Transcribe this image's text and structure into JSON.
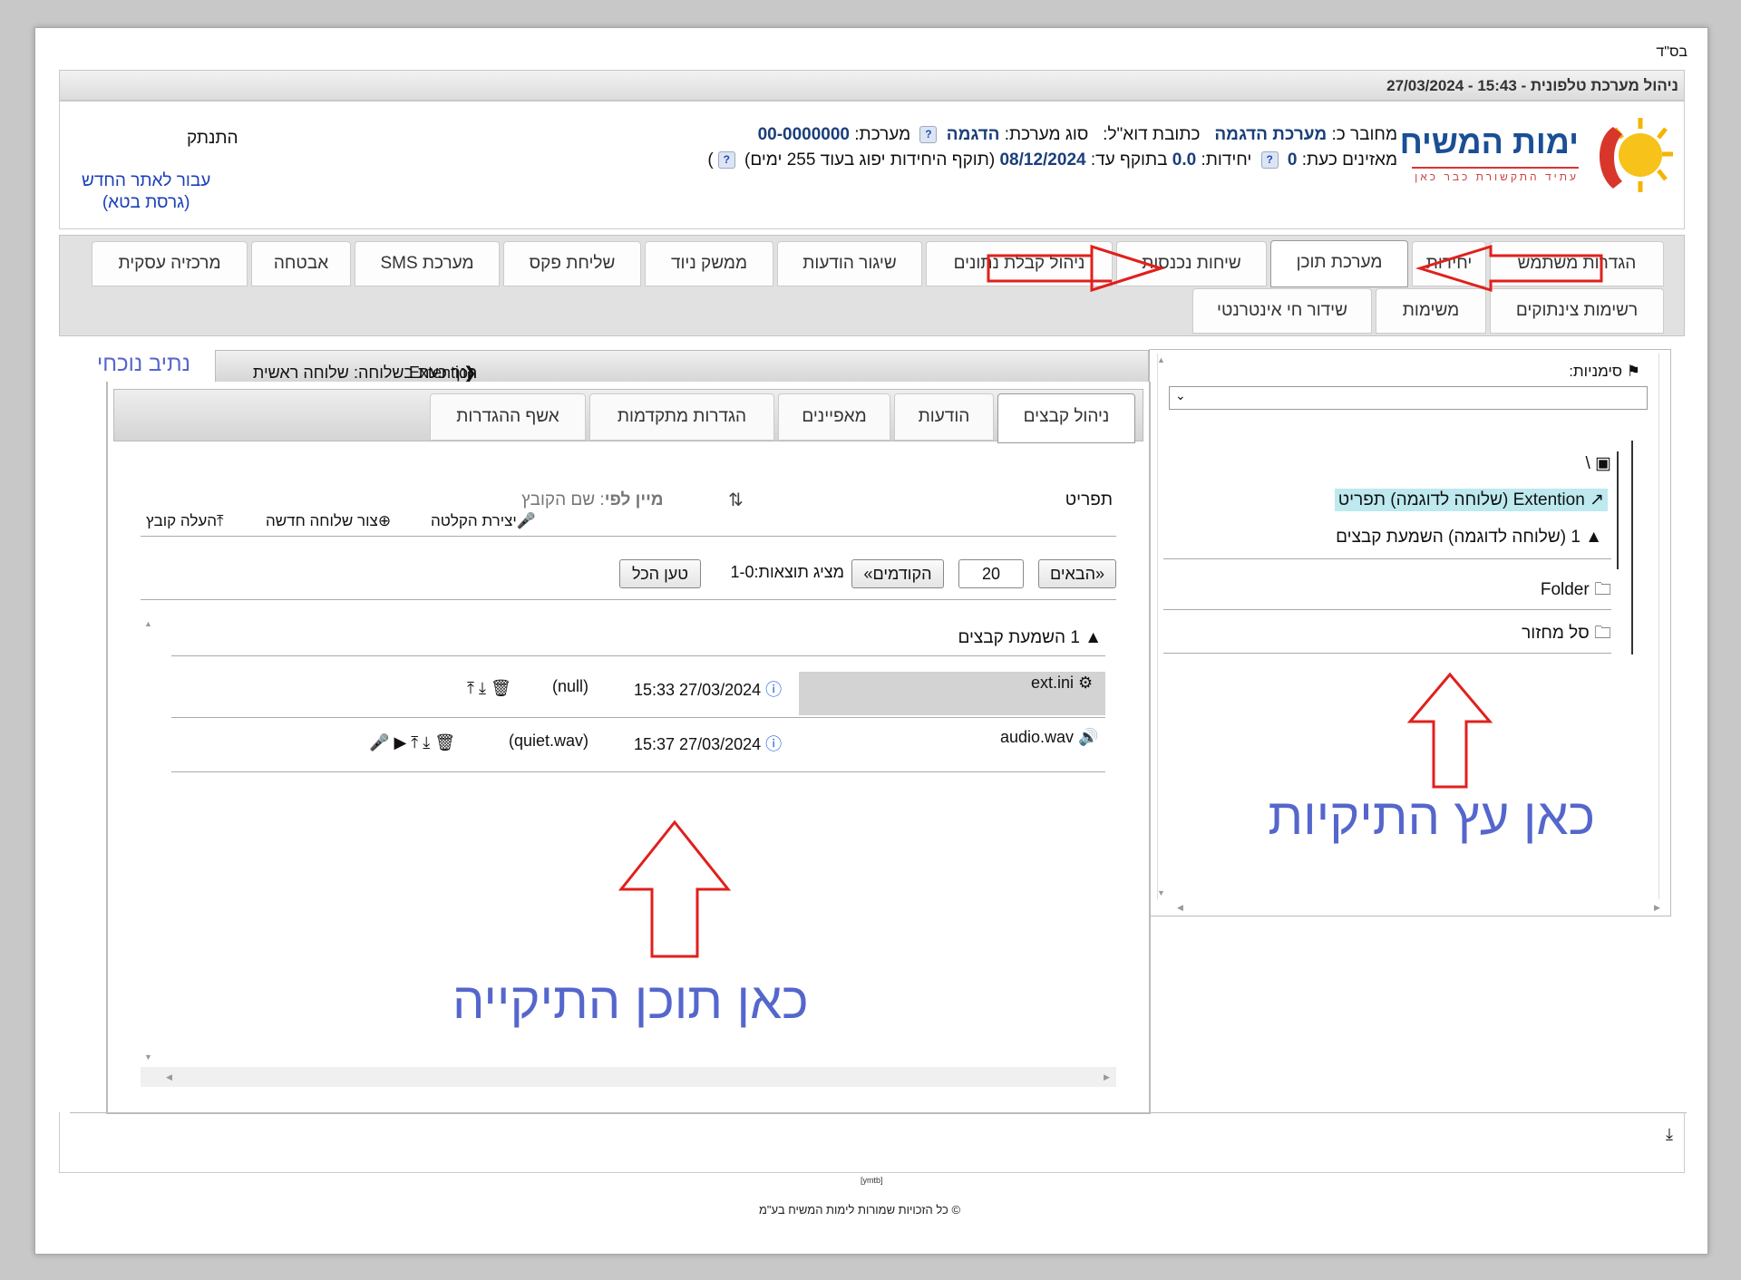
{
  "top": {
    "bsd": "בס\"ד",
    "title": "ניהול מערכת טלפונית - 15:43 - 27/03/2024"
  },
  "logo": {
    "name": "ימות המשיח",
    "slogan": "עתיד התקשורת כבר כאן"
  },
  "account": {
    "connected_label": "מחובר כ:",
    "connected_value": "מערכת הדגמה",
    "email_label": "כתובת דוא\"ל:",
    "system_type_label": "סוג מערכת:",
    "system_type_value": "הדגמה",
    "system_label": "מערכת:",
    "system_value": "00-0000000",
    "listeners_label": "מאזינים כעת:",
    "listeners_value": "0",
    "units_label": "יחידות:",
    "units_value": "0.0",
    "valid_label": "בתוקף עד:",
    "valid_value": "08/12/2024",
    "valid_note": "(תוקף היחידות יפוג בעוד 255 ימים)",
    "close_paren": ")",
    "help": "?"
  },
  "side_links": {
    "logout": "התנתק",
    "new_site_1": "עבור לאתר החדש",
    "new_site_2": "(גרסת בטא)"
  },
  "main_tabs": [
    "הגדרות משתמש",
    "יחידות",
    "מערכת תוכן",
    "שיחות נכנסות",
    "ניהול קבלת נתונים",
    "שיגור הודעות",
    "ממשק ניוד",
    "שליחת פקס",
    "מערכת SMS",
    "אבטחה",
    "מרכזיה עסקית",
    "רשימות צינתוקים",
    "משימות",
    "שידור חי אינטרנטי"
  ],
  "tree": {
    "bookmarks_label": "סימניות:",
    "root": "\\",
    "items": [
      "Extention (שלוחה לדוגמה) תפריט",
      "1 (שלוחה לדוגמה) השמעת קבצים",
      "Folder",
      "סל מחזור"
    ],
    "note": "כאן עץ התיקיות"
  },
  "path": {
    "label": "נתיב נוכחי",
    "text": "הנך כעת בשלוחה: שלוחה ראשית",
    "current": "Extention"
  },
  "sub_tabs": [
    "ניהול קבצים",
    "הודעות",
    "מאפיינים",
    "הגדרות מתקדמות",
    "אשף ההגדרות"
  ],
  "files": {
    "type_label": "תפריט",
    "sort_label": "מיין לפי",
    "sort_value": ": שם הקובץ",
    "create_recording": "יצירת הקלטה",
    "new_extension": "צור שלוחה חדשה",
    "upload_file": "העלה קובץ",
    "next": "«הבאים",
    "page_size": "20",
    "prev": "הקודמים»",
    "showing": "מציג תוצאות:1-0",
    "load_all": "טען הכל",
    "folder_row": "1 השמעת קבצים",
    "rows": [
      {
        "name": "ext.ini",
        "date": "15:33 27/03/2024",
        "extra": "(null)"
      },
      {
        "name": "audio.wav",
        "date": "15:37 27/03/2024",
        "extra": "(quiet.wav)"
      }
    ],
    "note": "כאן תוכן התיקייה"
  },
  "footer": {
    "small": "[ymtb]",
    "copyright": "© כל הזכויות שמורות לימות המשיח בע\"מ"
  },
  "colors": {
    "arrow": "#e0201c",
    "note": "#5566cc",
    "highlight": "#bde9ef"
  }
}
